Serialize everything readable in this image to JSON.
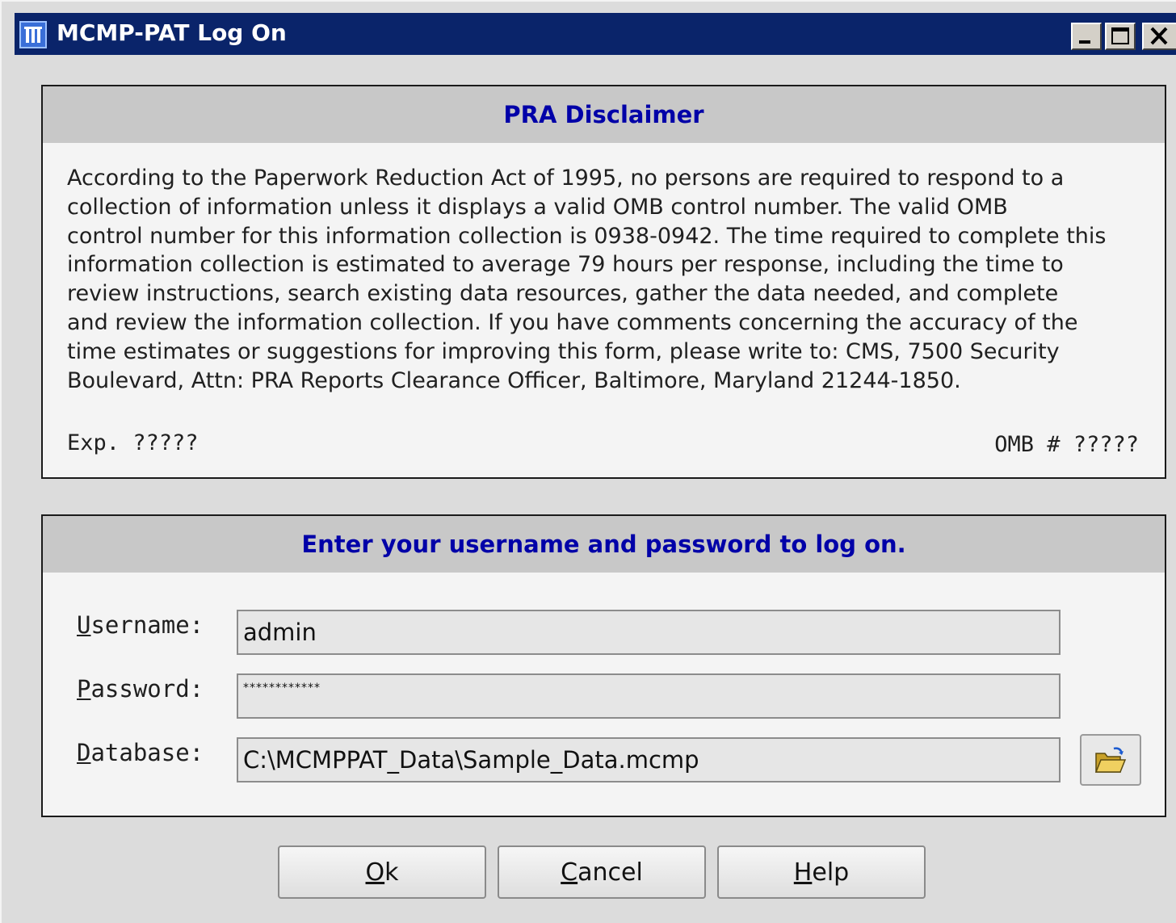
{
  "window": {
    "title": "MCMP-PAT Log On",
    "controls": [
      "minimize-icon",
      "maximize-icon",
      "close-icon"
    ]
  },
  "disclaimer": {
    "heading": "PRA Disclaimer",
    "lines": [
      "According to the Paperwork Reduction Act of 1995, no persons are required to respond to a",
      "collection of information unless it displays a valid OMB control number.  The valid OMB",
      "control number for this information collection is 0938-0942.  The time required to complete this",
      "information collection is estimated to average 79 hours per response, including the time to",
      "review instructions, search existing data resources, gather the data needed, and complete",
      "and review the information collection.  If you have comments concerning the accuracy of the",
      "time estimates or suggestions for improving this form, please write to: CMS, 7500 Security",
      "Boulevard, Attn: PRA Reports Clearance Officer, Baltimore, Maryland 21244-1850."
    ],
    "exp": "Exp. ?????",
    "omb": "OMB # ?????"
  },
  "login": {
    "heading": "Enter your username and password to log on.",
    "username_label_ul": "U",
    "username_label_rest": "sername:",
    "username_value": "admin",
    "password_label_ul": "P",
    "password_label_rest": "assword:",
    "password_value": "************",
    "database_label_ul": "D",
    "database_label_rest": "atabase:",
    "database_value": "C:\\MCMPPAT_Data\\Sample_Data.mcmp",
    "browse_icon": "open-folder-icon"
  },
  "buttons": {
    "ok_ul": "O",
    "ok_rest": "k",
    "cancel_ul": "C",
    "cancel_rest": "ancel",
    "help_ul": "H",
    "help_rest": "elp"
  },
  "colors": {
    "titlebar": "#0a246a",
    "heading_text": "#0000a8"
  }
}
